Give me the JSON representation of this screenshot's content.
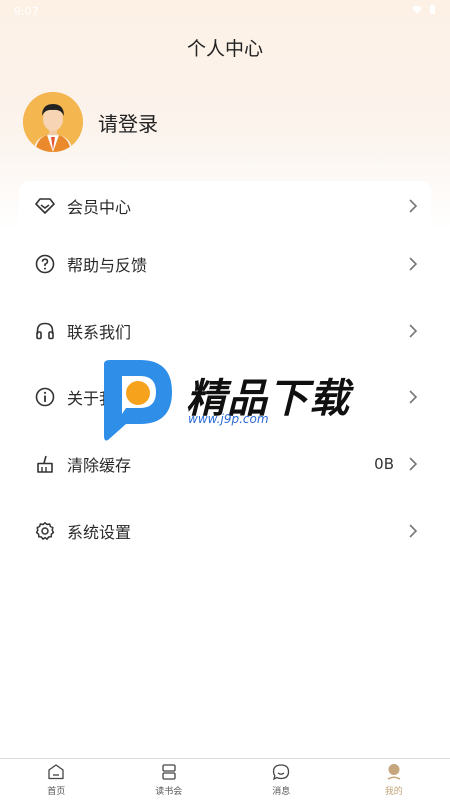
{
  "status_bar": {
    "time": "9:07"
  },
  "header": {
    "title": "个人中心"
  },
  "profile": {
    "login_text": "请登录"
  },
  "menu": {
    "items": [
      {
        "label": "会员中心",
        "icon": "diamond-icon",
        "value": ""
      },
      {
        "label": "帮助与反馈",
        "icon": "help-icon",
        "value": ""
      },
      {
        "label": "联系我们",
        "icon": "headphones-icon",
        "value": ""
      },
      {
        "label": "关于我们",
        "icon": "info-icon",
        "value": ""
      },
      {
        "label": "清除缓存",
        "icon": "broom-icon",
        "value": "0B"
      },
      {
        "label": "系统设置",
        "icon": "gear-icon",
        "value": ""
      }
    ]
  },
  "watermark": {
    "text": "精品下载",
    "url": "www.j9p.com"
  },
  "tab_bar": {
    "tabs": [
      {
        "label": "首页",
        "icon": "home-icon",
        "active": false
      },
      {
        "label": "读书会",
        "icon": "book-club-icon",
        "active": false
      },
      {
        "label": "消息",
        "icon": "message-icon",
        "active": false
      },
      {
        "label": "我的",
        "icon": "profile-icon",
        "active": true
      }
    ]
  },
  "colors": {
    "accent": "#c6a57c",
    "avatar_bg": "#f4b64f",
    "header_bg": "#fdf1e6"
  }
}
